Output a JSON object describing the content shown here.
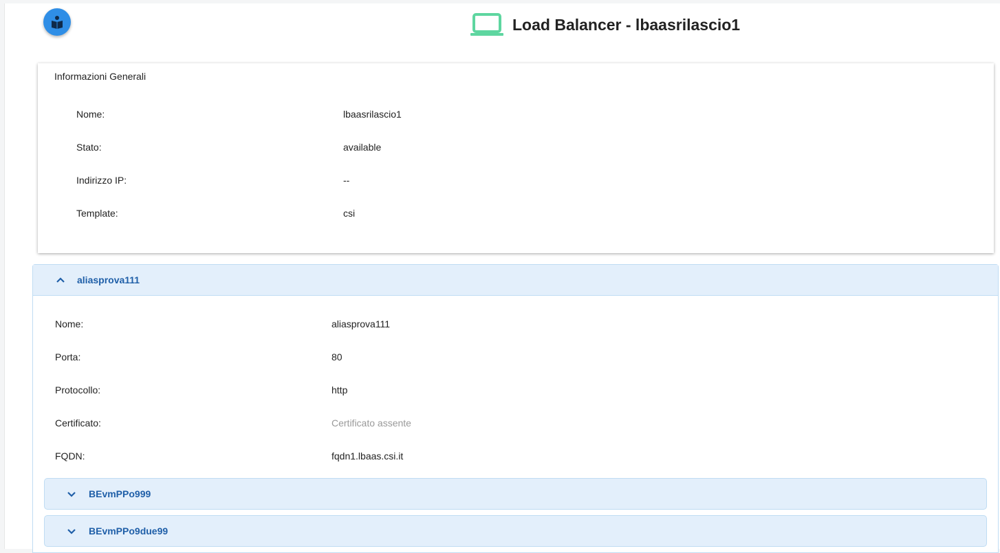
{
  "header": {
    "help_icon": "help-book-icon",
    "title_icon": "laptop-icon",
    "title": "Load Balancer - lbaasrilascio1",
    "icon_color": "#5ed6a0",
    "help_color": "#2f8ee6"
  },
  "general_info": {
    "title": "Informazioni Generali",
    "rows": [
      {
        "label": "Nome:",
        "value": "lbaasrilascio1"
      },
      {
        "label": "Stato:",
        "value": "available"
      },
      {
        "label": "Indirizzo IP:",
        "value": "--"
      },
      {
        "label": "Template:",
        "value": "csi"
      }
    ]
  },
  "listener": {
    "title": "aliasprova111",
    "expanded": true,
    "rows": [
      {
        "label": "Nome:",
        "value": "aliasprova111"
      },
      {
        "label": "Porta:",
        "value": "80"
      },
      {
        "label": "Protocollo:",
        "value": "http"
      },
      {
        "label": "Certificato:",
        "value": "Certificato assente"
      },
      {
        "label": "FQDN:",
        "value": "fqdn1.lbaas.csi.it"
      }
    ],
    "backends": [
      {
        "title": "BEvmPPo999",
        "expanded": false
      },
      {
        "title": "BEvmPPo9due99",
        "expanded": false
      }
    ]
  }
}
